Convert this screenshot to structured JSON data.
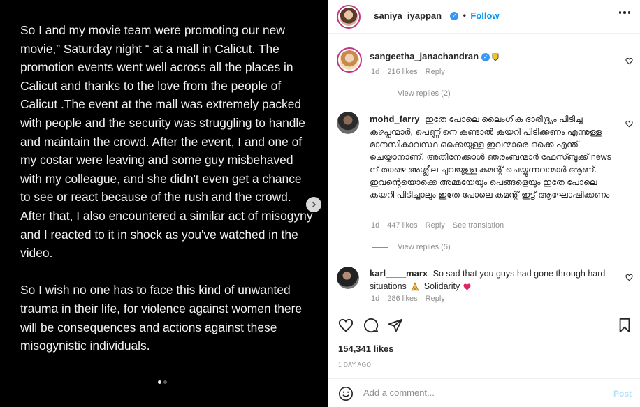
{
  "story": {
    "p1_a": "So I and my movie team were promoting our new movie,” ",
    "p1_title": "Saturday night",
    "p1_b": " “ at a mall in Calicut. The promotion events  went well across all the places in Calicut and thanks to the love from the people of Calicut .The event at the mall was extremely packed with people and the security was struggling to handle and maintain the crowd. After the event, I and one of my costar were leaving and some guy misbehaved with my colleague, and she didn't even get a chance to see or react because of the rush and the crowd. After that, I also encountered a similar act of misogyny and I reacted to it in shock as you've watched in the video.",
    "p2": "So I wish no one has to face this kind of unwanted trauma in their life, for violence against women there will be consequences and actions against these misogynistic individuals."
  },
  "carousel": {
    "total": 2,
    "current": 1
  },
  "header": {
    "username": "_saniya_iyappan_",
    "dot": "•",
    "follow_label": "Follow"
  },
  "comments": [
    {
      "username": "sangeetha_janachandran",
      "text": "",
      "time": "1d",
      "likes": "216 likes",
      "reply": "Reply",
      "view_replies": "View replies (2)"
    },
    {
      "username": "mohd_farry",
      "text": "ഇതേ പോലെ ലൈംഗിക ദാരിദ്ര്യം പിടിച്ച കഴപ്പന്മാർ, പെണ്ണിനെ കണ്ടാൽ കയറി പിടിക്കണം എന്നുള്ള മാനസികാവസ്ഥ ഒക്കെയുള്ള ഇവന്മാരെ ഒക്കെ എന്ത് ചെയ്യാനാണ്. അതിനേക്കാൾ ഞരംബന്മാർ ഫേസ്ബുക്ക് news ന് താഴെ അശ്ലീല ചുവയുള്ള കമന്റ് ചെയ്യുന്നവന്മാർ ആണ്. ഇവന്റെയൊക്കെ അമ്മയേയും പെങ്ങളെയും ഇതേ പോലെ കയറി പിടിച്ചാലും ഇതേ പോലെ കമന്റ് ഇട്ട് ആഘോഷിക്കണം",
      "time": "1d",
      "likes": "447 likes",
      "reply": "Reply",
      "translate": "See translation",
      "view_replies": "View replies (5)"
    },
    {
      "username": "karl____marx",
      "text": "So sad that you guys had gone through hard situations",
      "text_after": "Solidarity",
      "time": "1d",
      "likes": "286 likes",
      "reply": "Reply"
    }
  ],
  "post": {
    "likes": "154,341 likes",
    "time": "1 DAY AGO"
  },
  "add_comment": {
    "placeholder": "Add a comment...",
    "post_label": "Post"
  },
  "colors": {
    "media_bg": "#000000",
    "accent": "#0095f6",
    "verified": "#3897f0",
    "muted": "#8e8e8e"
  },
  "icons": [
    "chevron-right-icon",
    "verified-icon",
    "more-icon",
    "heart-icon",
    "comment-icon",
    "share-icon",
    "bookmark-icon",
    "emoji-icon",
    "badge-icon",
    "praying-hands-icon",
    "red-heart-icon"
  ]
}
